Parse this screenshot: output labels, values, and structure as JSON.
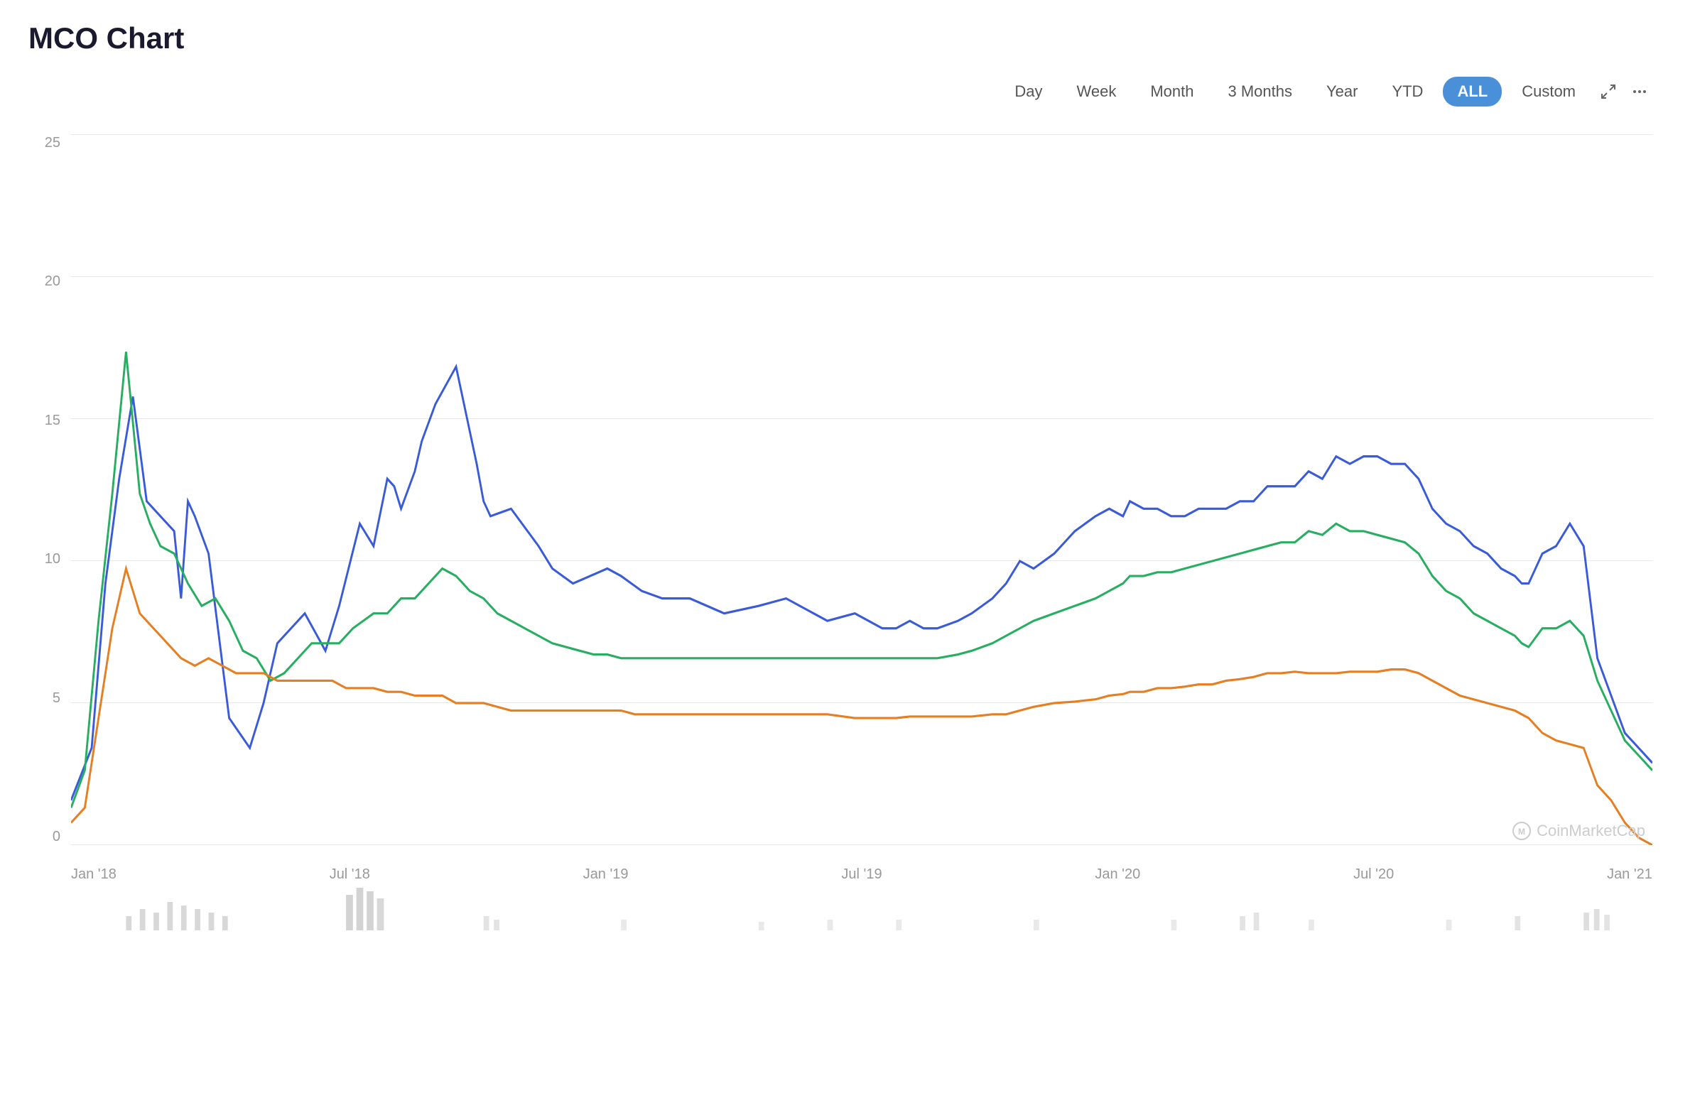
{
  "title": "MCO Chart",
  "toolbar": {
    "buttons": [
      {
        "id": "day",
        "label": "Day",
        "active": false
      },
      {
        "id": "week",
        "label": "Week",
        "active": false
      },
      {
        "id": "month",
        "label": "Month",
        "active": false
      },
      {
        "id": "3months",
        "label": "3 Months",
        "active": false
      },
      {
        "id": "year",
        "label": "Year",
        "active": false
      },
      {
        "id": "ytd",
        "label": "YTD",
        "active": false
      },
      {
        "id": "all",
        "label": "ALL",
        "active": true
      },
      {
        "id": "custom",
        "label": "Custom",
        "active": false
      }
    ]
  },
  "yAxis": {
    "labels": [
      "0",
      "5",
      "10",
      "15",
      "20",
      "25"
    ]
  },
  "xAxis": {
    "labels": [
      "Jan '18",
      "Jul '18",
      "Jan '19",
      "Jul '19",
      "Jan '20",
      "Jul '20",
      "Jan '21"
    ]
  },
  "watermark": "CoinMarketCap",
  "colors": {
    "blue": "#3a5bd9",
    "green": "#2ecc71",
    "orange": "#f39c12",
    "grid": "#e8e8e8",
    "active_btn": "#4a90d9"
  }
}
